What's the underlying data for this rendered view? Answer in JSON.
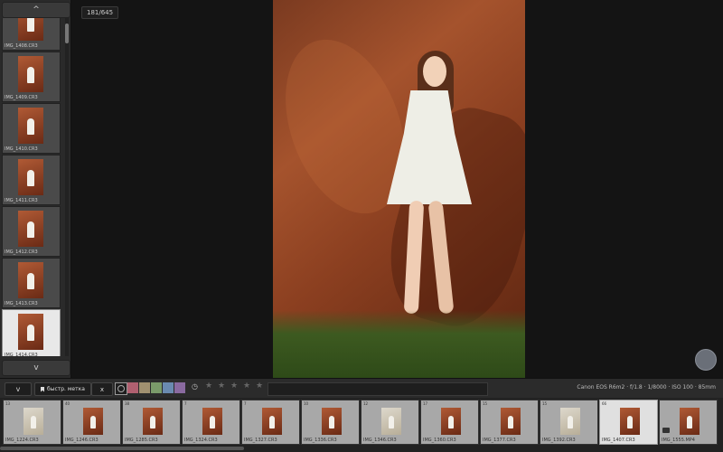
{
  "sidebar": {
    "scroll_up": "^",
    "scroll_down": "v",
    "items": [
      {
        "label": "IMG_1408.CR3",
        "selected": false
      },
      {
        "label": "IMG_1409.CR3",
        "selected": false
      },
      {
        "label": "IMG_1410.CR3",
        "selected": false
      },
      {
        "label": "IMG_1411.CR3",
        "selected": false
      },
      {
        "label": "IMG_1412.CR3",
        "selected": false
      },
      {
        "label": "IMG_1413.CR3",
        "selected": false
      },
      {
        "label": "IMG_1414.CR3",
        "selected": true
      }
    ]
  },
  "viewer": {
    "counter": "181/645"
  },
  "toolbar": {
    "dropdown_label": "v",
    "quick_mark_label": "быстр. метка",
    "close_label": "x",
    "color_labels": [
      "#b06070",
      "#a09070",
      "#7a9a6a",
      "#6a8ab0",
      "#8a6aa0"
    ],
    "rating_stars": [
      "★",
      "★",
      "★",
      "★",
      "★"
    ],
    "exif": "Canon EOS R6m2 · f/1.8 · 1/8000 · ISO 100 · 85mm"
  },
  "filmstrip": {
    "items": [
      {
        "num": "13",
        "label": "IMG_1224.CR3",
        "light": true,
        "selected": false
      },
      {
        "num": "40",
        "label": "IMG_1246.CR3",
        "light": false,
        "selected": false
      },
      {
        "num": "38",
        "label": "IMG_1285.CR3",
        "light": false,
        "selected": false
      },
      {
        "num": "7",
        "label": "IMG_1324.CR3",
        "light": false,
        "selected": false
      },
      {
        "num": "7",
        "label": "IMG_1327.CR3",
        "light": false,
        "selected": false
      },
      {
        "num": "10",
        "label": "IMG_1336.CR3",
        "light": false,
        "selected": false
      },
      {
        "num": "12",
        "label": "IMG_1346.CR3",
        "light": true,
        "selected": false
      },
      {
        "num": "17",
        "label": "IMG_1360.CR3",
        "light": false,
        "selected": false
      },
      {
        "num": "15",
        "label": "IMG_1377.CR3",
        "light": false,
        "selected": false
      },
      {
        "num": "15",
        "label": "IMG_1392.CR3",
        "light": true,
        "selected": false
      },
      {
        "num": "66",
        "label": "IMG_1407.CR3",
        "light": false,
        "selected": true
      },
      {
        "num": "",
        "label": "IMG_1555.MP4",
        "light": false,
        "selected": false,
        "video": true
      }
    ]
  }
}
